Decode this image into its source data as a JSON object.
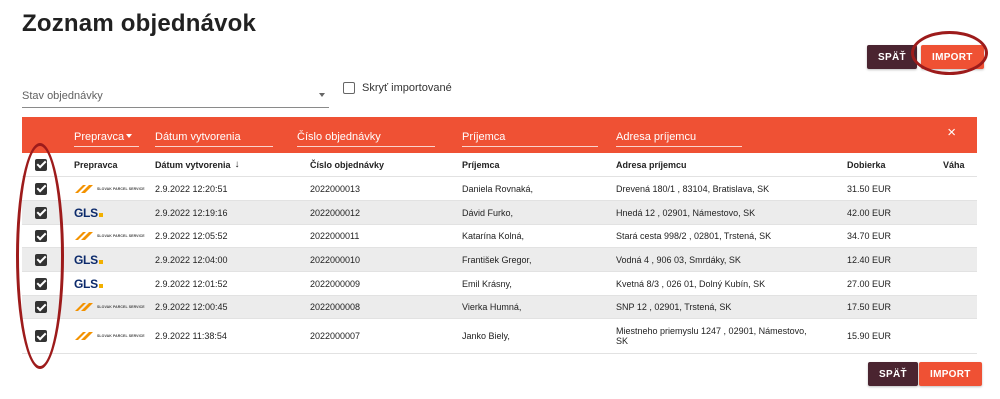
{
  "page_title": "Zoznam objednávok",
  "buttons": {
    "back_label": "SPÄŤ",
    "import_label": "IMPORT"
  },
  "filters": {
    "status_label": "Stav objednávky",
    "hide_imported_label": "Skryť importované"
  },
  "toolbar": {
    "carrier_label": "Prepravca",
    "date_label": "Dátum vytvorenia",
    "order_no_label": "Číslo objednávky",
    "recipient_label": "Príjemca",
    "address_label": "Adresa príjemcu",
    "close_icon": "×"
  },
  "table": {
    "columns": {
      "carrier": "Prepravca",
      "date": "Dátum vytvorenia",
      "sort_icon": "↓",
      "order_no": "Číslo objednávky",
      "recipient": "Príjemca",
      "address": "Adresa príjemcu",
      "cod": "Dobierka",
      "weight": "Váha"
    },
    "rows": [
      {
        "carrier": "sps",
        "date": "2.9.2022 12:20:51",
        "order_no": "2022000013",
        "recipient": "Daniela Rovnaká,",
        "address": "Drevená 180/1 , 83104, Bratislava, SK",
        "cod": "31.50 EUR",
        "weight": ""
      },
      {
        "carrier": "gls",
        "date": "2.9.2022 12:19:16",
        "order_no": "2022000012",
        "recipient": "Dávid Furko,",
        "address": "Hnedá 12 , 02901, Námestovo, SK",
        "cod": "42.00 EUR",
        "weight": ""
      },
      {
        "carrier": "sps",
        "date": "2.9.2022 12:05:52",
        "order_no": "2022000011",
        "recipient": "Katarína Kolná,",
        "address": "Stará cesta 998/2 , 02801, Trstená, SK",
        "cod": "34.70 EUR",
        "weight": ""
      },
      {
        "carrier": "gls",
        "date": "2.9.2022 12:04:00",
        "order_no": "2022000010",
        "recipient": "František Gregor,",
        "address": "Vodná 4 , 906 03, Smrdáky, SK",
        "cod": "12.40 EUR",
        "weight": ""
      },
      {
        "carrier": "gls",
        "date": "2.9.2022 12:01:52",
        "order_no": "2022000009",
        "recipient": "Emil Krásny,",
        "address": "Kvetná 8/3 , 026 01, Dolný Kubín, SK",
        "cod": "27.00 EUR",
        "weight": ""
      },
      {
        "carrier": "sps",
        "date": "2.9.2022 12:00:45",
        "order_no": "2022000008",
        "recipient": "Vierka Humná,",
        "address": "SNP 12 , 02901, Trstená, SK",
        "cod": "17.50 EUR",
        "weight": ""
      },
      {
        "carrier": "sps",
        "date": "2.9.2022 11:38:54",
        "order_no": "2022000007",
        "recipient": "Janko Biely,",
        "address": "Miestneho priemyslu 1247 , 02901, Námestovo, SK",
        "cod": "15.90 EUR",
        "weight": ""
      }
    ]
  },
  "logos": {
    "sps_text": "SLOVAK PARCEL SERVICE",
    "gls_text": "GLS"
  },
  "colors": {
    "accent": "#ef5134",
    "back_button": "#4a2430",
    "highlight": "#9d1b1b"
  }
}
